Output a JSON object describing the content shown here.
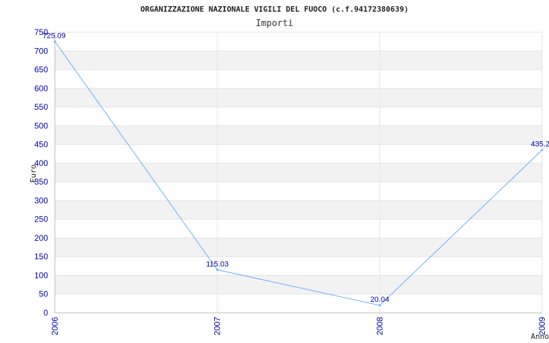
{
  "chart_data": {
    "type": "line",
    "title": "ORGANIZZAZIONE NAZIONALE VIGILI DEL FUOCO (c.f.94172380639)",
    "subtitle": "Importi",
    "xlabel": "Anno",
    "ylabel": "Euro",
    "categories": [
      "2006",
      "2007",
      "2008",
      "2009"
    ],
    "series": [
      {
        "values": [
          725.09,
          115.03,
          20.04,
          435.2
        ],
        "labels": [
          "725.09",
          "115.03",
          "20.04",
          "435.2"
        ]
      }
    ],
    "ylim": [
      0,
      750
    ],
    "yticks": [
      "0",
      "50",
      "100",
      "150",
      "200",
      "250",
      "300",
      "350",
      "400",
      "450",
      "500",
      "550",
      "600",
      "650",
      "700",
      "750"
    ],
    "grid": true,
    "line_color": "#66aaff",
    "tick_color": "#0000aa",
    "band_color": "#f2f2f2"
  }
}
